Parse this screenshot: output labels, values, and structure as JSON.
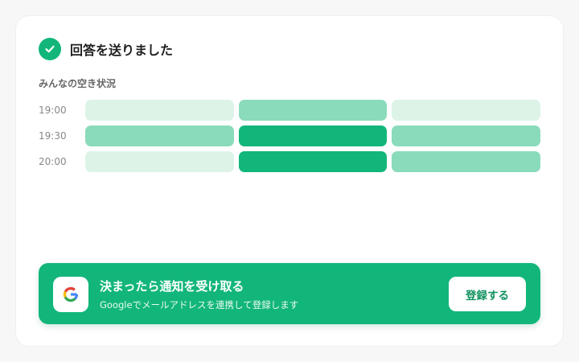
{
  "header": {
    "title": "回答を送りました",
    "icon": "check-icon"
  },
  "availability": {
    "title": "みんなの空き状況",
    "rows": [
      {
        "time": "19:00",
        "levels": [
          1,
          2,
          1
        ]
      },
      {
        "time": "19:30",
        "levels": [
          2,
          3,
          2
        ]
      },
      {
        "time": "20:00",
        "levels": [
          1,
          3,
          2
        ]
      }
    ],
    "level_colors": {
      "1": "#ddf3e8",
      "2": "#8adbbb",
      "3": "#12b67a"
    }
  },
  "banner": {
    "icon": "google-icon",
    "title": "決まったら通知を受け取る",
    "description": "Googleでメールアドレスを連携して登録します",
    "button_label": "登録する",
    "color": "#12b67a"
  }
}
